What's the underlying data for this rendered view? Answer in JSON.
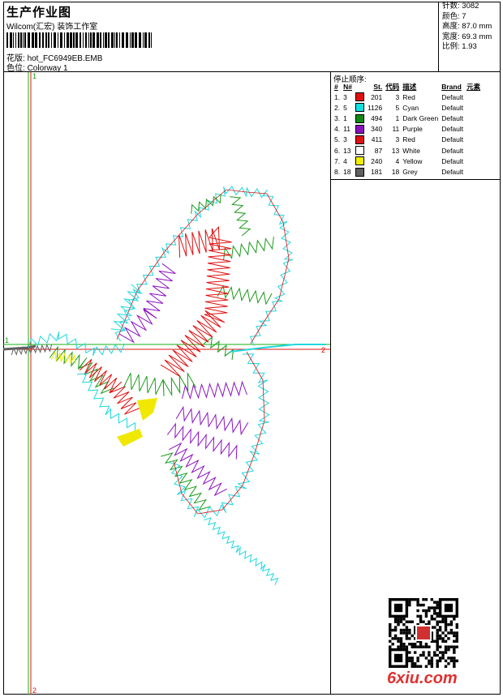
{
  "header": {
    "title": "生产作业图",
    "subtitle": "Wilcom(汇宏) 装饰工作室",
    "design_label": "花版:",
    "design_value": "hot_FC6949EB.EMB",
    "colorway_label": "色位:",
    "colorway_value": "Colorway 1"
  },
  "stats": [
    {
      "label": "针数:",
      "value": "3082"
    },
    {
      "label": "颜色:",
      "value": "7"
    },
    {
      "label": "高度:",
      "value": "87.0 mm"
    },
    {
      "label": "宽度:",
      "value": "69.3 mm"
    },
    {
      "label": "比例:",
      "value": "1.93"
    }
  ],
  "sequence": {
    "title": "停止顺序:",
    "headers": [
      "#",
      "N#",
      "",
      "St.",
      "代码",
      "描述",
      "Brand",
      "元素"
    ],
    "rows": [
      {
        "idx": "1.",
        "needle": "3",
        "color": "#e01010",
        "stitches": "201",
        "code": "3",
        "desc": "Red",
        "brand": "Default"
      },
      {
        "idx": "2.",
        "needle": "5",
        "color": "#10e0e0",
        "stitches": "1126",
        "code": "5",
        "desc": "Cyan",
        "brand": "Default"
      },
      {
        "idx": "3.",
        "needle": "1",
        "color": "#108a10",
        "stitches": "494",
        "code": "1",
        "desc": "Dark Green",
        "brand": "Default"
      },
      {
        "idx": "4.",
        "needle": "11",
        "color": "#8a10c0",
        "stitches": "340",
        "code": "11",
        "desc": "Purple",
        "brand": "Default"
      },
      {
        "idx": "5.",
        "needle": "3",
        "color": "#e01010",
        "stitches": "411",
        "code": "3",
        "desc": "Red",
        "brand": "Default"
      },
      {
        "idx": "6.",
        "needle": "13",
        "color": "#ffffff",
        "stitches": "87",
        "code": "13",
        "desc": "White",
        "brand": "Default"
      },
      {
        "idx": "7.",
        "needle": "4",
        "color": "#f0f000",
        "stitches": "240",
        "code": "4",
        "desc": "Yellow",
        "brand": "Default"
      },
      {
        "idx": "8.",
        "needle": "18",
        "color": "#606060",
        "stitches": "181",
        "code": "18",
        "desc": "Grey",
        "brand": "Default"
      }
    ]
  },
  "axes": {
    "v_top": "1",
    "v_bottom": "2",
    "h_left": "1",
    "h_right": "2"
  },
  "watermark": "6xiu.com"
}
